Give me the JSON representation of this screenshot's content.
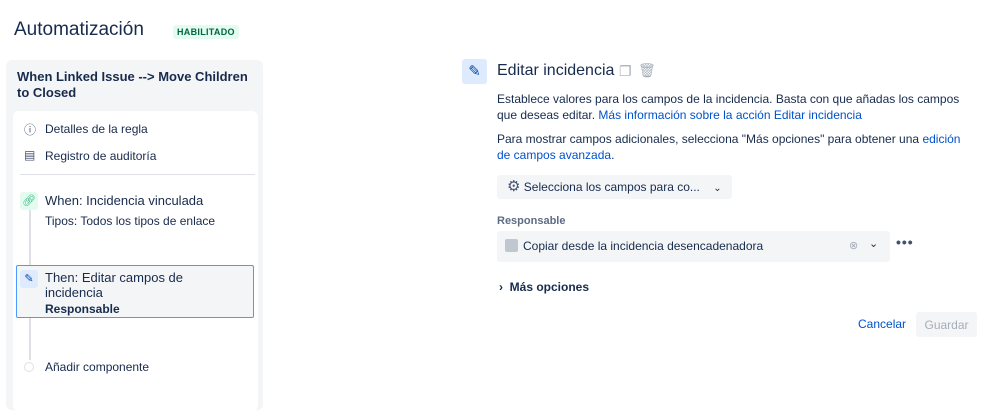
{
  "header": {
    "title": "Automatización",
    "status_badge": "HABILITADO"
  },
  "sidebar": {
    "rule_name": "When Linked Issue --> Move Children to Closed",
    "links": [
      {
        "label": "Detalles de la regla",
        "icon": "info-icon"
      },
      {
        "label": "Registro de auditoría",
        "icon": "document-icon"
      }
    ],
    "trigger": {
      "title": "When: Incidencia vinculada",
      "detail": "Tipos: Todos los tipos de enlace",
      "icon": "link-icon"
    },
    "action": {
      "title": "Then: Editar campos de incidencia",
      "detail": "Responsable",
      "icon": "pencil-icon"
    },
    "add_component": "Añadir componente"
  },
  "panel": {
    "title": "Editar incidencia",
    "desc1": "Establece valores para los campos de la incidencia. Basta con que añadas los campos que deseas editar.",
    "desc1_link": "Más información sobre la acción Editar incidencia",
    "desc2": "Para mostrar campos adicionales, selecciona \"Más opciones\" para obtener una",
    "desc2_link": "edición de campos avanzada",
    "desc2_end": ".",
    "field_picker": "Selecciona los campos para co...",
    "field_label": "Responsable",
    "field_value": "Copiar desde la incidencia desencadenadora",
    "more_options": "Más opciones",
    "cancel": "Cancelar",
    "save": "Guardar"
  },
  "colors": {
    "accent": "#0052cc",
    "selected_border": "#4c9aff",
    "badge_bg": "#e3fcef"
  }
}
